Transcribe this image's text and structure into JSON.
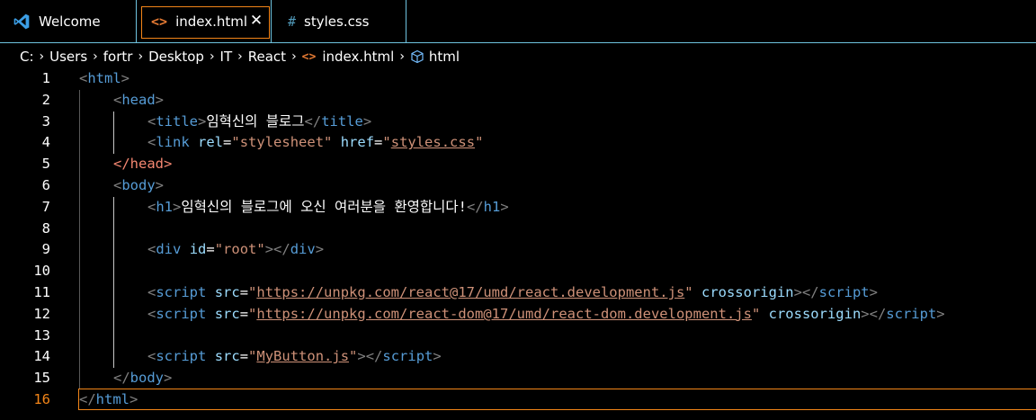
{
  "tabs": [
    {
      "label": "Welcome",
      "icon": "vscode-icon"
    },
    {
      "label": "index.html",
      "icon": "html-file-icon",
      "active": true
    },
    {
      "label": "styles.css",
      "icon": "css-file-icon"
    }
  ],
  "icons": {
    "html": "<>",
    "css": "#",
    "close": "✕"
  },
  "breadcrumb": [
    "C:",
    "Users",
    "fortr",
    "Desktop",
    "IT",
    "React",
    "index.html",
    "html"
  ],
  "editor": {
    "current_line": 16,
    "lines": [
      {
        "n": "1"
      },
      {
        "n": "2"
      },
      {
        "n": "3"
      },
      {
        "n": "4"
      },
      {
        "n": "5"
      },
      {
        "n": "6"
      },
      {
        "n": "7"
      },
      {
        "n": "8"
      },
      {
        "n": "9"
      },
      {
        "n": "10"
      },
      {
        "n": "11"
      },
      {
        "n": "12"
      },
      {
        "n": "13"
      },
      {
        "n": "14"
      },
      {
        "n": "15"
      },
      {
        "n": "16"
      }
    ],
    "code": {
      "title_text": "임혁신의 블로그",
      "stylesheet": "stylesheet",
      "href": "styles.css",
      "h1_text": "임혁신의 블로그에 오신 여러분을 환영합니다!",
      "div_id": "root",
      "react_src": "https://unpkg.com/react@17/umd/react.development.js",
      "react_dom_src": "https://unpkg.com/react-dom@17/umd/react-dom.development.js",
      "crossorigin": "crossorigin",
      "mybutton_src": "MyButton.js"
    }
  },
  "colors": {
    "tag": "#569cd6",
    "attribute": "#9cdcfe",
    "string": "#ce9178",
    "bracket": "#808080",
    "accent_border": "#f38518",
    "tab_border": "#6fc3df"
  }
}
